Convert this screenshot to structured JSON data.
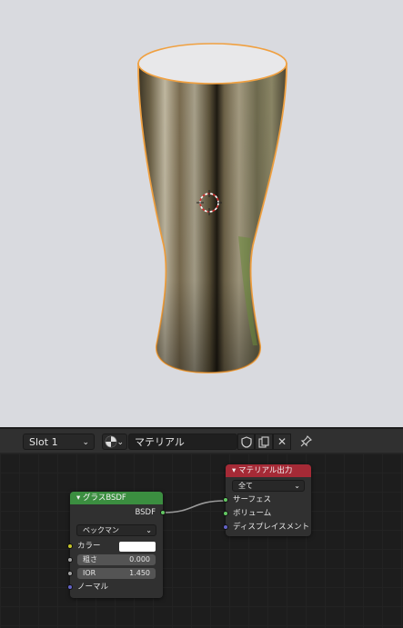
{
  "header": {
    "slot_label": "Slot 1",
    "material_name": "マテリアル"
  },
  "nodes": {
    "glass_bsdf": {
      "title": "グラスBSDF",
      "output_label": "BSDF",
      "distribution": "ベックマン",
      "color_label": "カラー",
      "roughness_label": "粗さ",
      "roughness_value": "0.000",
      "ior_label": "IOR",
      "ior_value": "1.450",
      "normal_label": "ノーマル",
      "header_color": "#3b8e40"
    },
    "material_output": {
      "title": "マテリアル出力",
      "target": "全て",
      "surface_label": "サーフェス",
      "volume_label": "ボリューム",
      "displacement_label": "ディスプレイスメント",
      "header_color": "#a52a36"
    }
  },
  "colors": {
    "selection_outline": "#f0a040",
    "socket_shader": "#63c763",
    "socket_color": "#c7c729",
    "socket_float": "#a1a1a1",
    "socket_vector": "#6363c7"
  }
}
